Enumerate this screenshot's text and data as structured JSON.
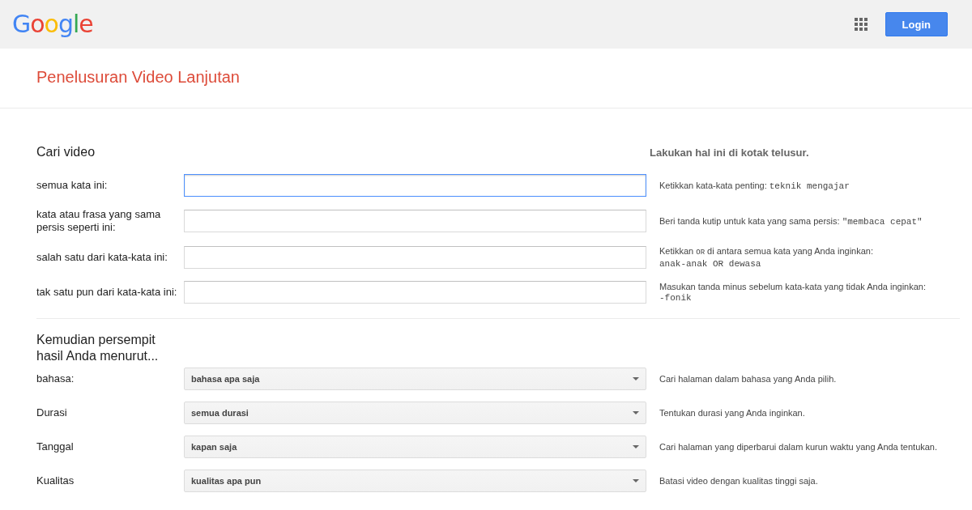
{
  "header": {
    "logo": "Google",
    "login_button": "Login"
  },
  "page_title": "Penelusuran Video Lanjutan",
  "search_section": {
    "heading": "Cari video",
    "hint_heading": "Lakukan hal ini di kotak telusur.",
    "fields": [
      {
        "label": "semua kata ini:",
        "focused": true,
        "hint": [
          {
            "kind": "plain",
            "text": "Ketikkan kata-kata penting: "
          },
          {
            "kind": "code",
            "text": "teknik mengajar"
          }
        ]
      },
      {
        "label": "kata atau frasa yang sama persis seperti ini:",
        "focused": false,
        "hint": [
          {
            "kind": "plain",
            "text": "Beri tanda kutip untuk kata yang sama persis: "
          },
          {
            "kind": "code",
            "text": "\"membaca cepat\""
          }
        ]
      },
      {
        "label": "salah satu dari kata-kata ini:",
        "focused": false,
        "hint": [
          {
            "kind": "plain",
            "text": "Ketikkan "
          },
          {
            "kind": "small-code",
            "text": "OR"
          },
          {
            "kind": "plain",
            "text": " di antara semua kata yang Anda inginkan:"
          },
          {
            "kind": "code-line",
            "text": "anak-anak OR dewasa"
          }
        ]
      },
      {
        "label": "tak satu pun dari kata-kata ini:",
        "focused": false,
        "hint": [
          {
            "kind": "plain",
            "text": "Masukan tanda minus sebelum kata-kata yang tidak Anda inginkan:"
          },
          {
            "kind": "code-line",
            "text": "-fonik"
          }
        ]
      }
    ]
  },
  "narrow_section": {
    "heading": "Kemudian persempit hasil Anda menurut...",
    "filters": [
      {
        "label": "bahasa:",
        "value": "bahasa apa saja",
        "hint": "Cari halaman dalam bahasa yang Anda pilih."
      },
      {
        "label": "Durasi",
        "value": "semua durasi",
        "hint": "Tentukan durasi yang Anda inginkan."
      },
      {
        "label": "Tanggal",
        "value": "kapan saja",
        "hint": "Cari halaman yang diperbarui dalam kurun waktu yang Anda tentukan."
      },
      {
        "label": "Kualitas",
        "value": "kualitas apa pun",
        "hint": "Batasi video dengan kualitas tinggi saja."
      }
    ]
  }
}
